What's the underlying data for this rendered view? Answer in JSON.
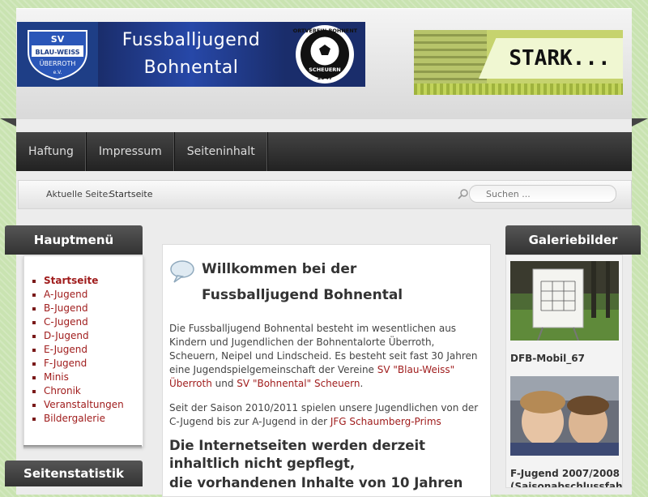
{
  "header": {
    "banner_title_line1": "Fussballjugend",
    "banner_title_line2": "Bohnental",
    "crest_left_top": "SV",
    "crest_left_mid": "BLAU-WEISS",
    "crest_left_bot": "ÜBERROTH",
    "crest_left_ev": "e.V.",
    "crest_right_ring": "SPORTVEREIN BOHNENTAL",
    "crest_right_city": "SCHEUERN",
    "crest_right_year": "1947",
    "stark_text": "STARK..."
  },
  "nav": {
    "items": [
      {
        "label": "Haftung"
      },
      {
        "label": "Impressum"
      },
      {
        "label": "Seiteninhalt"
      }
    ]
  },
  "breadcrumb": {
    "label": "Aktuelle Seite:",
    "current": "Startseite"
  },
  "search": {
    "placeholder": "Suchen ..."
  },
  "left_menu": {
    "title": "Hauptmenü",
    "items": [
      {
        "label": "Startseite",
        "active": true
      },
      {
        "label": "A-Jugend"
      },
      {
        "label": "B-Jugend"
      },
      {
        "label": "C-Jugend"
      },
      {
        "label": "D-Jugend"
      },
      {
        "label": "E-Jugend"
      },
      {
        "label": "F-Jugend"
      },
      {
        "label": "Minis"
      },
      {
        "label": "Chronik"
      },
      {
        "label": "Veranstaltungen"
      },
      {
        "label": "Bildergalerie"
      }
    ]
  },
  "stats": {
    "title": "Seitenstatistik"
  },
  "main": {
    "title": "Willkommen bei der Fussballjugend Bohnental",
    "p1_text_a": "Die Fussballjugend Bohnental besteht im wesentlichen aus Kindern und Jugendlichen der Bohnentalorte Überroth, Scheuern, Neipel und Lindscheid. Es besteht seit fast 30 Jahren eine Jugendspielgemeinschaft der Vereine ",
    "p1_link_1": "SV \"Blau-Weiss\" Überroth",
    "p1_text_b": " und ",
    "p1_link_2": "SV \"Bohnental\" Scheuern",
    "p1_text_c": ".",
    "p2_text_a": "Seit der Saison 2010/2011 spielen unsere Jugendlichen von der C-Jugend bis zur A-Jugend in der ",
    "p2_link": "JFG Schaumberg-Prims",
    "heading_notice_1": "Die Internetseiten werden derzeit inhaltlich nicht gepflegt,",
    "heading_notice_2": "die vorhandenen Inhalte von 10 Jahren"
  },
  "gallery": {
    "title": "Galeriebilder",
    "items": [
      {
        "caption": "DFB-Mobil_67"
      },
      {
        "caption": "F-Jugend 2007/2008",
        "caption2": "(Saisonabschlussfahrt"
      }
    ]
  },
  "colors": {
    "link": "#a01d1d",
    "nav_bg": "#333333",
    "page_bg": "#c9e3b1"
  }
}
